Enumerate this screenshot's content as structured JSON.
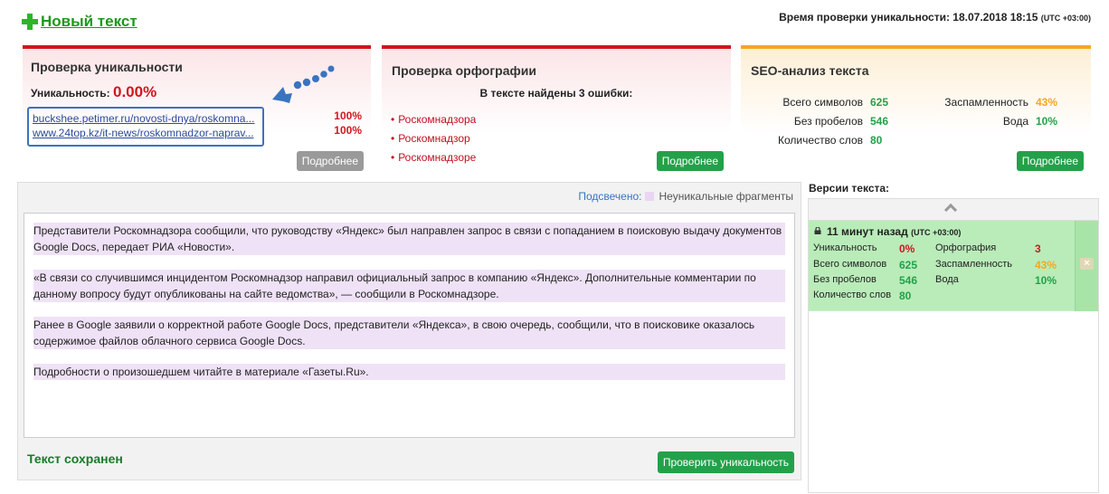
{
  "header": {
    "new_text_label": "Новый текст",
    "check_time_label": "Время проверки уникальности: 18.07.2018 18:15",
    "check_time_tz": "(UTC +03:00)"
  },
  "uniqueness": {
    "title": "Проверка уникальности",
    "label": "Уникальность:",
    "value": "0.00%",
    "sources": [
      {
        "url": "buckshee.petimer.ru/novosti-dnya/roskomna...",
        "percent": "100%"
      },
      {
        "url": "www.24top.kz/it-news/roskomnadzor-naprav...",
        "percent": "100%"
      }
    ],
    "more_button": "Подробнее"
  },
  "spelling": {
    "title": "Проверка орфографии",
    "summary": "В тексте найдены 3 ошибки:",
    "errors": [
      "Роскомнадзора",
      "Роскомнадзор",
      "Роскомнадзоре"
    ],
    "more_button": "Подробнее"
  },
  "seo": {
    "title": "SEO-анализ текста",
    "left": [
      {
        "label": "Всего символов",
        "value": "625"
      },
      {
        "label": "Без пробелов",
        "value": "546"
      },
      {
        "label": "Количество слов",
        "value": "80"
      }
    ],
    "right": [
      {
        "label": "Заспамленность",
        "value": "43%"
      },
      {
        "label": "Вода",
        "value": "10%"
      }
    ],
    "more_button": "Подробнее"
  },
  "editor": {
    "legend_highlighted": "Подсвечено:",
    "legend_nonunique": "Неуникальные фрагменты",
    "paragraphs": [
      "Представители Роскомнадзора сообщили, что руководству «Яндекс» был направлен запрос в связи с попаданием в поисковую выдачу документов Google Docs, передает РИА «Новости».",
      "«В связи со случившимся инцидентом Роскомнадзор направил официальный запрос в компанию «Яндекс». Дополнительные комментарии по данному вопросу будут опубликованы на сайте ведомства», — сообщили в Роскомнадзоре.",
      "Ранее в Google заявили о корректной работе Google Docs, представители «Яндекса», в свою очередь, сообщили, что в поисковике оказалось содержимое файлов облачного сервиса Google Docs.",
      "Подробности о произошедшем читайте в материале «Газеты.Ru»."
    ],
    "saved_label": "Текст сохранен",
    "check_button": "Проверить уникальность"
  },
  "versions": {
    "title": "Версии текста:",
    "items": [
      {
        "time": "11 минут назад",
        "tz": "(UTC +03:00)",
        "uniqueness_label": "Уникальность",
        "uniqueness": "0%",
        "spelling_label": "Орфография",
        "spelling": "3",
        "chars_label": "Всего символов",
        "chars": "625",
        "spam_label": "Заспамленность",
        "spam": "43%",
        "nospace_label": "Без пробелов",
        "nospace": "546",
        "water_label": "Вода",
        "water": "10%",
        "words_label": "Количество слов",
        "words": "80"
      }
    ]
  },
  "colors": {
    "red": "#d0161f",
    "green": "#23a14a",
    "orange": "#f5a623",
    "highlight": "#efe2f6"
  }
}
